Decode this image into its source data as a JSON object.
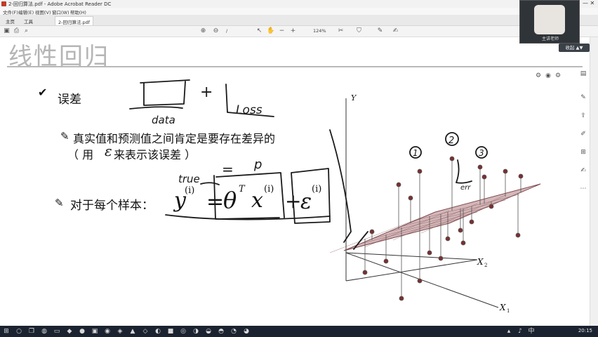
{
  "window": {
    "title": "2-回归算法.pdf - Adobe Acrobat Reader DC",
    "menu": [
      "文件(F)",
      "编辑(E)",
      "视图(V)",
      "窗口(W)",
      "帮助(H)"
    ],
    "tabs": {
      "home": "主页",
      "tools": "工具",
      "document": "2-回归算法.pdf"
    },
    "zoom": "124%",
    "page_indicator": "/"
  },
  "webcam": {
    "label": "主讲老师",
    "button": "收起 ▲▼"
  },
  "slide": {
    "title": "线性回归",
    "bullet_heading": "误差",
    "sub_line1": "真实值和预测值之间肯定是要存在差异的",
    "sub_line2_open": "（ 用 ",
    "epsilon": "ε",
    "sub_line2_rest": " 来表示该误差 ）",
    "per_sample_label": "对于每个样本：",
    "eq": {
      "y": "y",
      "sup_i": "(i)",
      "equals": "=",
      "theta": "θ",
      "sup_T": "T",
      "x": "x",
      "plus": "+",
      "eps": "ε"
    },
    "axis_y": "Y",
    "axis_x1": "X",
    "axis_x1_sub": "1",
    "axis_x2": "X",
    "axis_x2_sub": "2"
  },
  "handwriting": {
    "data": "data",
    "loss": "Loss",
    "true": "true",
    "p": "p",
    "err": "err",
    "plus": "+",
    "equals": "=",
    "num1": "1",
    "num2": "2",
    "num3": "3"
  },
  "taskbar": {
    "clock": "20:15"
  },
  "colors": {
    "handwriting": "#1a1a1a",
    "plane": "#8a5a5e",
    "points": "#7b2f2f",
    "taskbar": "#1c2330"
  }
}
